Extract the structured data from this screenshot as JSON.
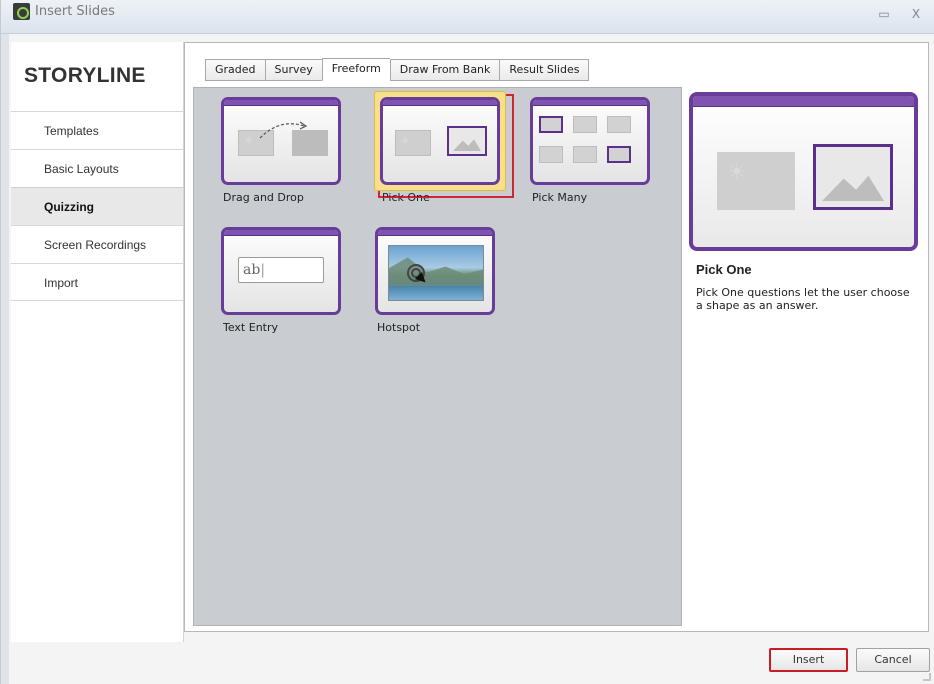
{
  "window": {
    "title": "Insert Slides"
  },
  "sidebar": {
    "brand": "STORYLINE",
    "items": [
      {
        "label": "Templates"
      },
      {
        "label": "Basic Layouts"
      },
      {
        "label": "Quizzing",
        "active": true
      },
      {
        "label": "Screen Recordings"
      },
      {
        "label": "Import"
      }
    ]
  },
  "tabs": [
    {
      "label": "Graded"
    },
    {
      "label": "Survey"
    },
    {
      "label": "Freeform",
      "active": true
    },
    {
      "label": "Draw From Bank"
    },
    {
      "label": "Result Slides"
    }
  ],
  "tiles": [
    {
      "label": "Drag and Drop",
      "icon": "drag-and-drop-thumbnail"
    },
    {
      "label": "Pick One",
      "icon": "pick-one-thumbnail",
      "selected": true
    },
    {
      "label": "Pick Many",
      "icon": "pick-many-thumbnail"
    },
    {
      "label": "Text Entry",
      "icon": "text-entry-thumbnail",
      "sample_text": "ab"
    },
    {
      "label": "Hotspot",
      "icon": "hotspot-thumbnail"
    }
  ],
  "preview": {
    "title": "Pick One",
    "description": "Pick One questions let the user choose a shape as an answer."
  },
  "footer": {
    "insert_label": "Insert",
    "cancel_label": "Cancel"
  },
  "colors": {
    "accent_purple": "#6a3c9a",
    "selection_red": "#d0262f",
    "highlight_yellow": "#f7df8c",
    "grid_background": "#c9cdd1"
  }
}
